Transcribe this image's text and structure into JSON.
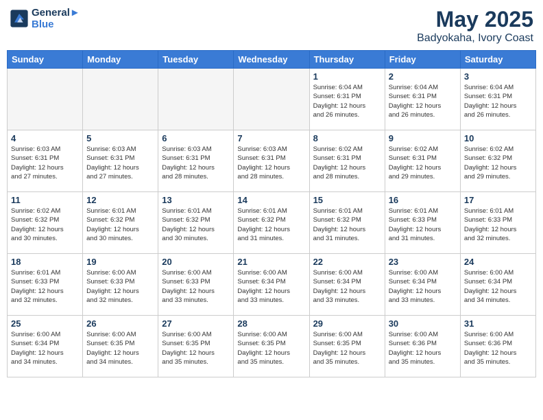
{
  "logo": {
    "line1": "General",
    "line2": "Blue"
  },
  "title": "May 2025",
  "location": "Badyokaha, Ivory Coast",
  "weekdays": [
    "Sunday",
    "Monday",
    "Tuesday",
    "Wednesday",
    "Thursday",
    "Friday",
    "Saturday"
  ],
  "weeks": [
    [
      {
        "day": "",
        "info": ""
      },
      {
        "day": "",
        "info": ""
      },
      {
        "day": "",
        "info": ""
      },
      {
        "day": "",
        "info": ""
      },
      {
        "day": "1",
        "info": "Sunrise: 6:04 AM\nSunset: 6:31 PM\nDaylight: 12 hours\nand 26 minutes."
      },
      {
        "day": "2",
        "info": "Sunrise: 6:04 AM\nSunset: 6:31 PM\nDaylight: 12 hours\nand 26 minutes."
      },
      {
        "day": "3",
        "info": "Sunrise: 6:04 AM\nSunset: 6:31 PM\nDaylight: 12 hours\nand 26 minutes."
      }
    ],
    [
      {
        "day": "4",
        "info": "Sunrise: 6:03 AM\nSunset: 6:31 PM\nDaylight: 12 hours\nand 27 minutes."
      },
      {
        "day": "5",
        "info": "Sunrise: 6:03 AM\nSunset: 6:31 PM\nDaylight: 12 hours\nand 27 minutes."
      },
      {
        "day": "6",
        "info": "Sunrise: 6:03 AM\nSunset: 6:31 PM\nDaylight: 12 hours\nand 28 minutes."
      },
      {
        "day": "7",
        "info": "Sunrise: 6:03 AM\nSunset: 6:31 PM\nDaylight: 12 hours\nand 28 minutes."
      },
      {
        "day": "8",
        "info": "Sunrise: 6:02 AM\nSunset: 6:31 PM\nDaylight: 12 hours\nand 28 minutes."
      },
      {
        "day": "9",
        "info": "Sunrise: 6:02 AM\nSunset: 6:31 PM\nDaylight: 12 hours\nand 29 minutes."
      },
      {
        "day": "10",
        "info": "Sunrise: 6:02 AM\nSunset: 6:32 PM\nDaylight: 12 hours\nand 29 minutes."
      }
    ],
    [
      {
        "day": "11",
        "info": "Sunrise: 6:02 AM\nSunset: 6:32 PM\nDaylight: 12 hours\nand 30 minutes."
      },
      {
        "day": "12",
        "info": "Sunrise: 6:01 AM\nSunset: 6:32 PM\nDaylight: 12 hours\nand 30 minutes."
      },
      {
        "day": "13",
        "info": "Sunrise: 6:01 AM\nSunset: 6:32 PM\nDaylight: 12 hours\nand 30 minutes."
      },
      {
        "day": "14",
        "info": "Sunrise: 6:01 AM\nSunset: 6:32 PM\nDaylight: 12 hours\nand 31 minutes."
      },
      {
        "day": "15",
        "info": "Sunrise: 6:01 AM\nSunset: 6:32 PM\nDaylight: 12 hours\nand 31 minutes."
      },
      {
        "day": "16",
        "info": "Sunrise: 6:01 AM\nSunset: 6:33 PM\nDaylight: 12 hours\nand 31 minutes."
      },
      {
        "day": "17",
        "info": "Sunrise: 6:01 AM\nSunset: 6:33 PM\nDaylight: 12 hours\nand 32 minutes."
      }
    ],
    [
      {
        "day": "18",
        "info": "Sunrise: 6:01 AM\nSunset: 6:33 PM\nDaylight: 12 hours\nand 32 minutes."
      },
      {
        "day": "19",
        "info": "Sunrise: 6:00 AM\nSunset: 6:33 PM\nDaylight: 12 hours\nand 32 minutes."
      },
      {
        "day": "20",
        "info": "Sunrise: 6:00 AM\nSunset: 6:33 PM\nDaylight: 12 hours\nand 33 minutes."
      },
      {
        "day": "21",
        "info": "Sunrise: 6:00 AM\nSunset: 6:34 PM\nDaylight: 12 hours\nand 33 minutes."
      },
      {
        "day": "22",
        "info": "Sunrise: 6:00 AM\nSunset: 6:34 PM\nDaylight: 12 hours\nand 33 minutes."
      },
      {
        "day": "23",
        "info": "Sunrise: 6:00 AM\nSunset: 6:34 PM\nDaylight: 12 hours\nand 33 minutes."
      },
      {
        "day": "24",
        "info": "Sunrise: 6:00 AM\nSunset: 6:34 PM\nDaylight: 12 hours\nand 34 minutes."
      }
    ],
    [
      {
        "day": "25",
        "info": "Sunrise: 6:00 AM\nSunset: 6:34 PM\nDaylight: 12 hours\nand 34 minutes."
      },
      {
        "day": "26",
        "info": "Sunrise: 6:00 AM\nSunset: 6:35 PM\nDaylight: 12 hours\nand 34 minutes."
      },
      {
        "day": "27",
        "info": "Sunrise: 6:00 AM\nSunset: 6:35 PM\nDaylight: 12 hours\nand 35 minutes."
      },
      {
        "day": "28",
        "info": "Sunrise: 6:00 AM\nSunset: 6:35 PM\nDaylight: 12 hours\nand 35 minutes."
      },
      {
        "day": "29",
        "info": "Sunrise: 6:00 AM\nSunset: 6:35 PM\nDaylight: 12 hours\nand 35 minutes."
      },
      {
        "day": "30",
        "info": "Sunrise: 6:00 AM\nSunset: 6:36 PM\nDaylight: 12 hours\nand 35 minutes."
      },
      {
        "day": "31",
        "info": "Sunrise: 6:00 AM\nSunset: 6:36 PM\nDaylight: 12 hours\nand 35 minutes."
      }
    ]
  ]
}
